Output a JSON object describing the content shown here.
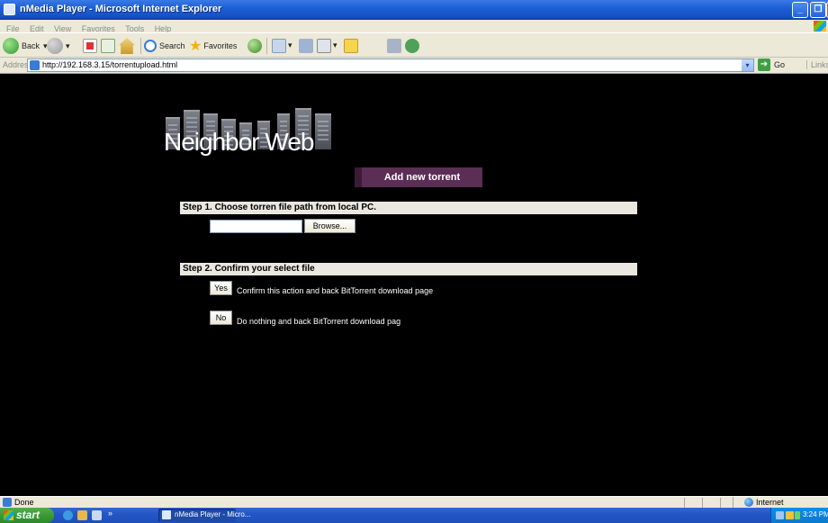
{
  "window": {
    "title": "nMedia Player - Microsoft Internet Explorer",
    "buttons": {
      "minimize": "_",
      "maximize": "❐"
    }
  },
  "menu": [
    "File",
    "Edit",
    "View",
    "Favorites",
    "Tools",
    "Help"
  ],
  "toolbar": {
    "back_label": "Back",
    "search_label": "Search",
    "favorites_label": "Favorites",
    "dropdown_arrow": "▾"
  },
  "address": {
    "label": "Address",
    "url": "http://192.168.3.15/torrentupload.html",
    "go_label": "Go",
    "links_label": "Links"
  },
  "page": {
    "brand": "Neighbor Web",
    "add_button": "Add new torrent",
    "step1": {
      "header": "Step 1. Choose torren file path from local PC.",
      "browse_label": "Browse..."
    },
    "step2": {
      "header": "Step 2. Confirm your select file",
      "yes_label": "Yes",
      "yes_desc": "Confirm this action and back BitTorrent download page",
      "no_label": "No",
      "no_desc": "Do nothing and back BitTorrent download pag"
    }
  },
  "status": {
    "text": "Done",
    "zone": "Internet"
  },
  "taskbar": {
    "start_label": "start",
    "task_item": "nMedia Player - Micro...",
    "clock": "3:24 PM"
  },
  "colors": {
    "titlebar": "#1d5fd4",
    "page_background": "#000000",
    "add_button": "#5b2e55",
    "step_header": "#e9e7df"
  }
}
